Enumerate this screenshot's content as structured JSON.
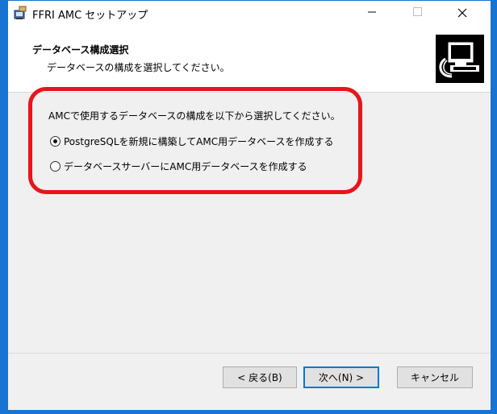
{
  "window": {
    "title": "FFRI AMC セットアップ"
  },
  "header": {
    "title": "データベース構成選択",
    "subtitle": "データベースの構成を選択してください。"
  },
  "content": {
    "instruction": "AMCで使用するデータベースの構成を以下から選択してください。",
    "options": [
      {
        "label": "PostgreSQLを新規に構築してAMC用データベースを作成する",
        "selected": true
      },
      {
        "label": "データベースサーバーにAMC用データベースを作成する",
        "selected": false
      }
    ]
  },
  "buttons": {
    "back": "< 戻る(B)",
    "next": "次へ(N) >",
    "cancel": "キャンセル"
  },
  "icons": {
    "minimize": "minimize-icon",
    "maximize": "maximize-icon",
    "close": "close-icon",
    "app": "installer-icon",
    "header": "computer-graphic-icon"
  },
  "colors": {
    "highlight": "#e8151a",
    "desktop": "#1874d3",
    "default_button_border": "#0078d7"
  }
}
